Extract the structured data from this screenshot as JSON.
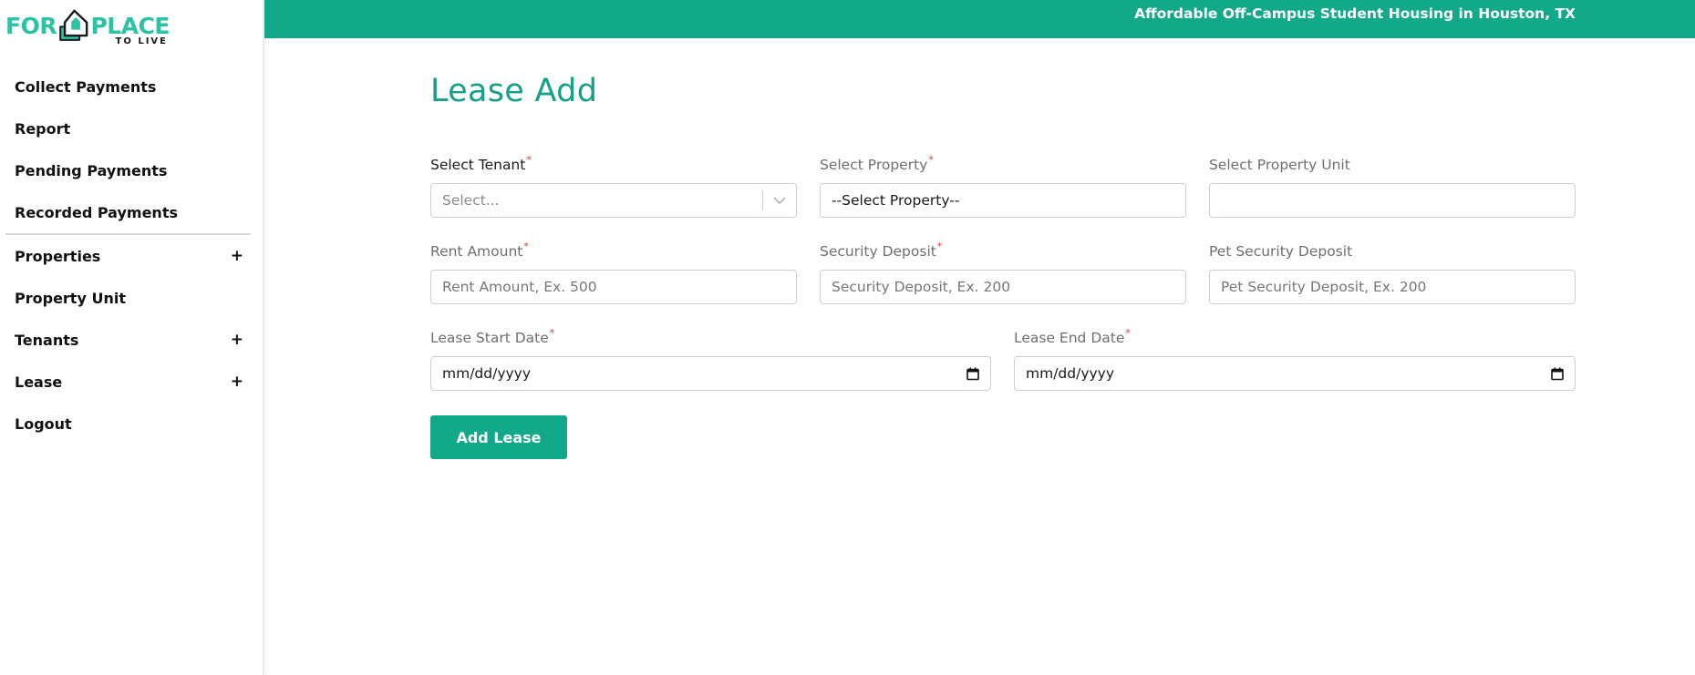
{
  "brand": {
    "logo_left": "FOR",
    "logo_right": "PLACE",
    "logo_sub": "TO LIVE",
    "accent_color": "#12a98a",
    "logo_color": "#2cc3a4"
  },
  "header": {
    "tagline": "Affordable Off-Campus Student Housing in Houston, TX"
  },
  "sidebar": {
    "items": [
      {
        "label": "Collect Payments",
        "expandable": false
      },
      {
        "label": "Report",
        "expandable": false
      },
      {
        "label": "Pending Payments",
        "expandable": false
      },
      {
        "label": "Recorded Payments",
        "expandable": false
      },
      {
        "label": "Properties",
        "expandable": true,
        "icon": "+"
      },
      {
        "label": "Property Unit",
        "expandable": false
      },
      {
        "label": "Tenants",
        "expandable": true,
        "icon": "+"
      },
      {
        "label": "Lease",
        "expandable": true,
        "icon": "+"
      },
      {
        "label": "Logout",
        "expandable": false
      }
    ]
  },
  "page": {
    "title": "Lease Add"
  },
  "form": {
    "required_mark": "*",
    "select_tenant": {
      "label": "Select Tenant",
      "placeholder": "Select..."
    },
    "select_property": {
      "label": "Select Property",
      "value": "--Select Property--"
    },
    "select_property_unit": {
      "label": "Select Property Unit",
      "value": ""
    },
    "rent_amount": {
      "label": "Rent Amount",
      "placeholder": "Rent Amount, Ex. 500"
    },
    "security_deposit": {
      "label": "Security Deposit",
      "placeholder": "Security Deposit, Ex. 200"
    },
    "pet_security_deposit": {
      "label": "Pet Security Deposit",
      "placeholder": "Pet Security Deposit, Ex. 200"
    },
    "lease_start_date": {
      "label": "Lease Start Date",
      "value": "mm/dd/yyyy"
    },
    "lease_end_date": {
      "label": "Lease End Date",
      "value": "mm/dd/yyyy"
    },
    "submit_label": "Add Lease"
  },
  "icons": {
    "chevron": "chevron-down-icon",
    "calendar": "calendar-icon",
    "plus": "plus-icon",
    "logo": "house-logo-icon"
  }
}
